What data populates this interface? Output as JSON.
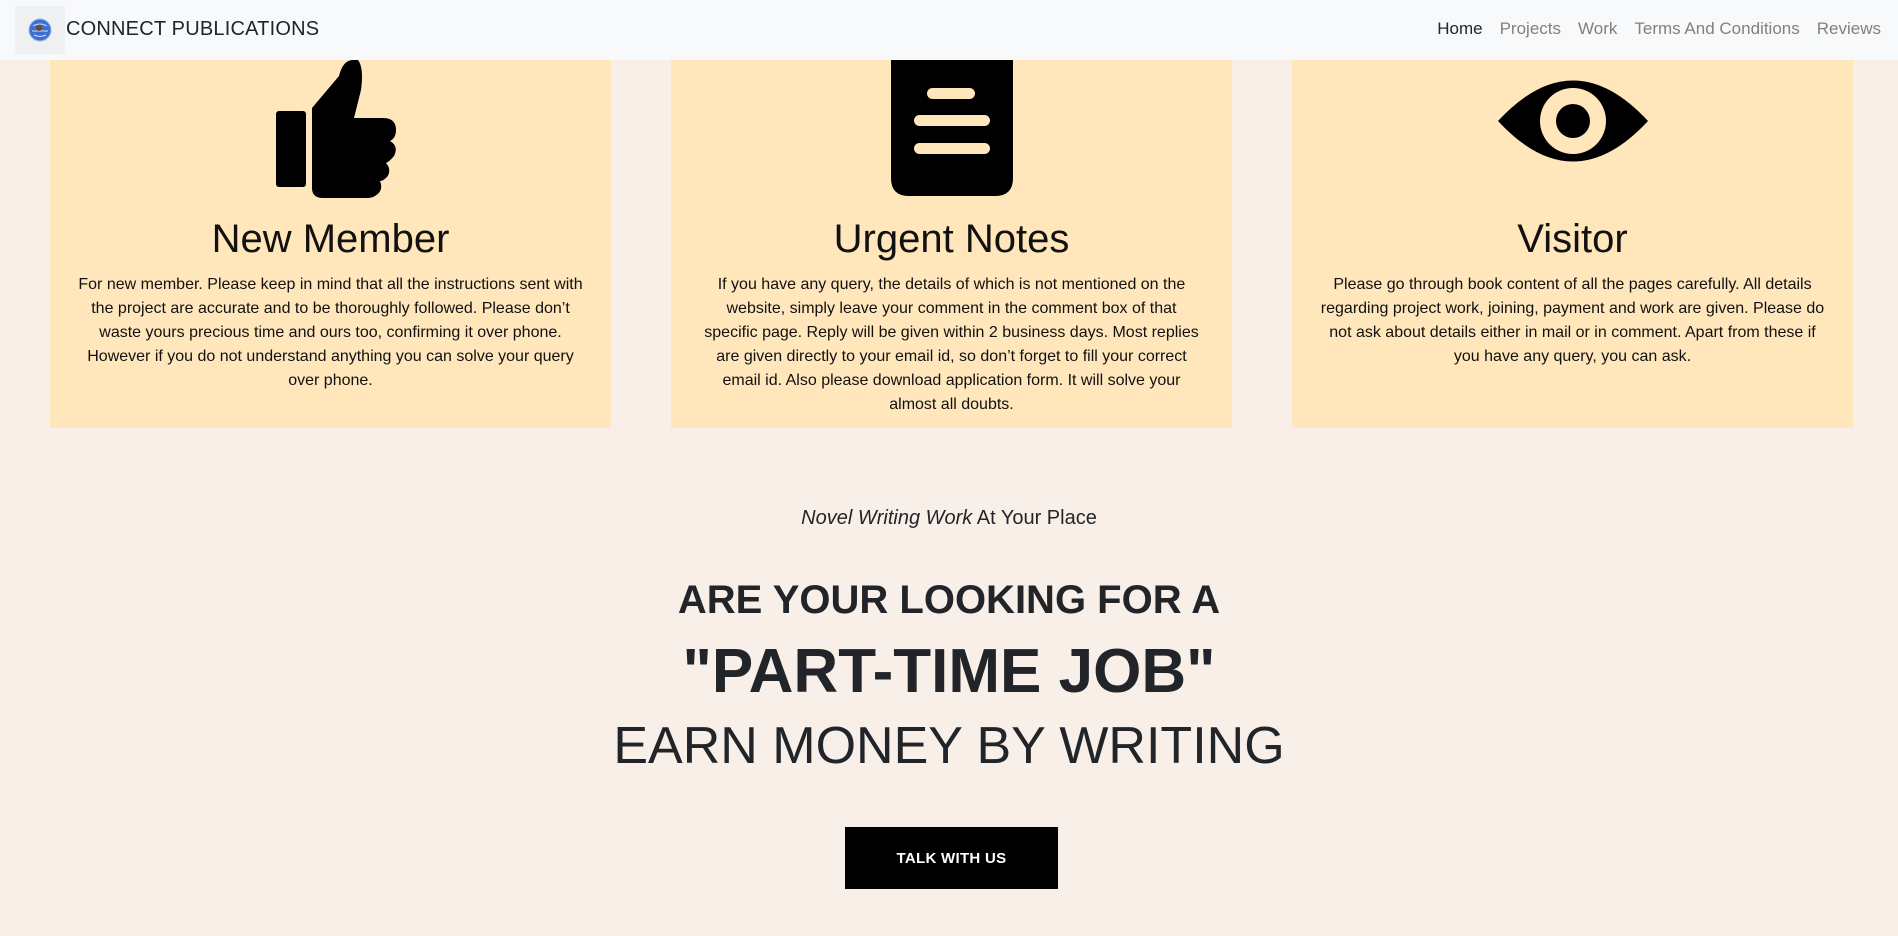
{
  "navbar": {
    "brand": "CONNECT PUBLICATIONS",
    "links": [
      {
        "label": "Home"
      },
      {
        "label": "Projects"
      },
      {
        "label": "Work"
      },
      {
        "label": "Terms And Conditions"
      },
      {
        "label": "Reviews"
      }
    ]
  },
  "cards": [
    {
      "icon": "thumbs-up-icon",
      "title": "New Member",
      "text": "For new member. Please keep in mind that all the instructions sent with the project are accurate and to be thoroughly followed. Please don’t waste yours precious time and ours too, confirming it over phone. However if you do not understand anything you can solve your query over phone."
    },
    {
      "icon": "document-icon",
      "title": "Urgent Notes",
      "text": "If you have any query, the details of which is not mentioned on the website, simply leave your comment in the comment box of that specific page. Reply will be given within 2 business days. Most replies are given directly to your email id, so don’t forget to fill your correct email id. Also please download application form. It will solve your almost all doubts."
    },
    {
      "icon": "eye-icon",
      "title": "Visitor",
      "text": "Please go through book content of all the pages carefully. All details regarding project work, joining, payment and work are given. Please do not ask about details either in mail or in comment. Apart from these if you have any query, you can ask."
    }
  ],
  "hero": {
    "tagline_emphasis": "Novel Writing Work",
    "tagline_rest": " At Your Place",
    "headline_1": "ARE YOUR LOOKING FOR A",
    "headline_2": "\"PART-TIME JOB\"",
    "headline_3": "EARN MONEY BY WRITING",
    "cta_label": "TALK WITH US"
  },
  "colors": {
    "page_background": "#f8efe8",
    "card_background": "#ffe6bb",
    "navbar_background": "#f8f9fa",
    "cta_background": "#000000"
  }
}
